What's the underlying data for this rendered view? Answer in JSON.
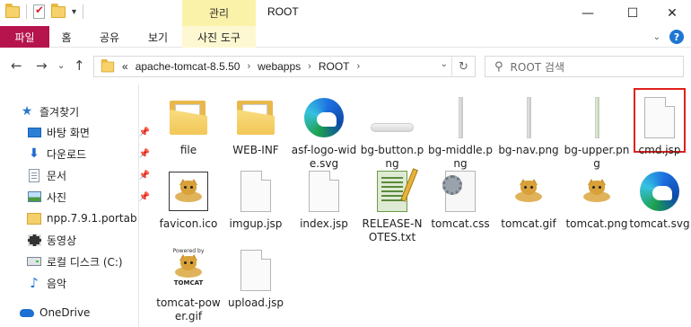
{
  "window": {
    "title": "ROOT",
    "context_group": "관리",
    "controls": {
      "minimize": "—",
      "maximize": "☐",
      "close": "✕"
    }
  },
  "ribbon": {
    "tabs": [
      "파일",
      "홈",
      "공유",
      "보기",
      "사진 도구"
    ],
    "file_color": "#b5144c"
  },
  "navigation": {
    "back": "←",
    "forward": "→",
    "recent": "⌄",
    "up": "↑",
    "overflow": "«",
    "path": [
      "apache-tomcat-8.5.50",
      "webapps",
      "ROOT"
    ],
    "separator": "›",
    "refresh": "↻",
    "search_placeholder": "ROOT 검색"
  },
  "sidebar": {
    "items": [
      {
        "label": "즐겨찾기",
        "icon": "star-icon",
        "pinned": false
      },
      {
        "label": "바탕 화면",
        "icon": "desktop-icon",
        "pinned": true
      },
      {
        "label": "다운로드",
        "icon": "download-icon",
        "pinned": true
      },
      {
        "label": "문서",
        "icon": "document-icon",
        "pinned": true
      },
      {
        "label": "사진",
        "icon": "pictures-icon",
        "pinned": true
      },
      {
        "label": "npp.7.9.1.portab",
        "icon": "folder-icon",
        "pinned": false
      },
      {
        "label": "동영상",
        "icon": "video-icon",
        "pinned": false
      },
      {
        "label": "로컬 디스크 (C:)",
        "icon": "drive-icon",
        "pinned": false
      },
      {
        "label": "음악",
        "icon": "music-icon",
        "pinned": false
      },
      {
        "label": "OneDrive",
        "icon": "cloud-icon",
        "pinned": false
      }
    ]
  },
  "files": [
    {
      "name": "file",
      "icon": "folder-icon"
    },
    {
      "name": "WEB-INF",
      "icon": "folder-icon"
    },
    {
      "name": "asf-logo-wide.svg",
      "icon": "edge-icon"
    },
    {
      "name": "bg-button.png",
      "icon": "png-icon"
    },
    {
      "name": "bg-middle.png",
      "icon": "png-icon"
    },
    {
      "name": "bg-nav.png",
      "icon": "png-icon"
    },
    {
      "name": "bg-upper.png",
      "icon": "png-icon"
    },
    {
      "name": "cmd.jsp",
      "icon": "document-icon",
      "highlighted": true
    },
    {
      "name": "favicon.ico",
      "icon": "tomcat-icon"
    },
    {
      "name": "imgup.jsp",
      "icon": "document-icon"
    },
    {
      "name": "index.jsp",
      "icon": "document-icon"
    },
    {
      "name": "RELEASE-NOTES.txt",
      "icon": "text-icon"
    },
    {
      "name": "tomcat.css",
      "icon": "css-icon"
    },
    {
      "name": "tomcat.gif",
      "icon": "tomcat-icon"
    },
    {
      "name": "tomcat.png",
      "icon": "tomcat-icon"
    },
    {
      "name": "tomcat.svg",
      "icon": "edge-icon"
    },
    {
      "name": "tomcat-power.gif",
      "icon": "tomcat-powered-icon"
    },
    {
      "name": "upload.jsp",
      "icon": "document-icon"
    }
  ],
  "powered_by": {
    "line1": "Powered by",
    "line2": "TOMCAT"
  },
  "colors": {
    "highlight": "#e0201e",
    "context_tab": "#fbf2a9",
    "accent": "#1e76d2"
  }
}
